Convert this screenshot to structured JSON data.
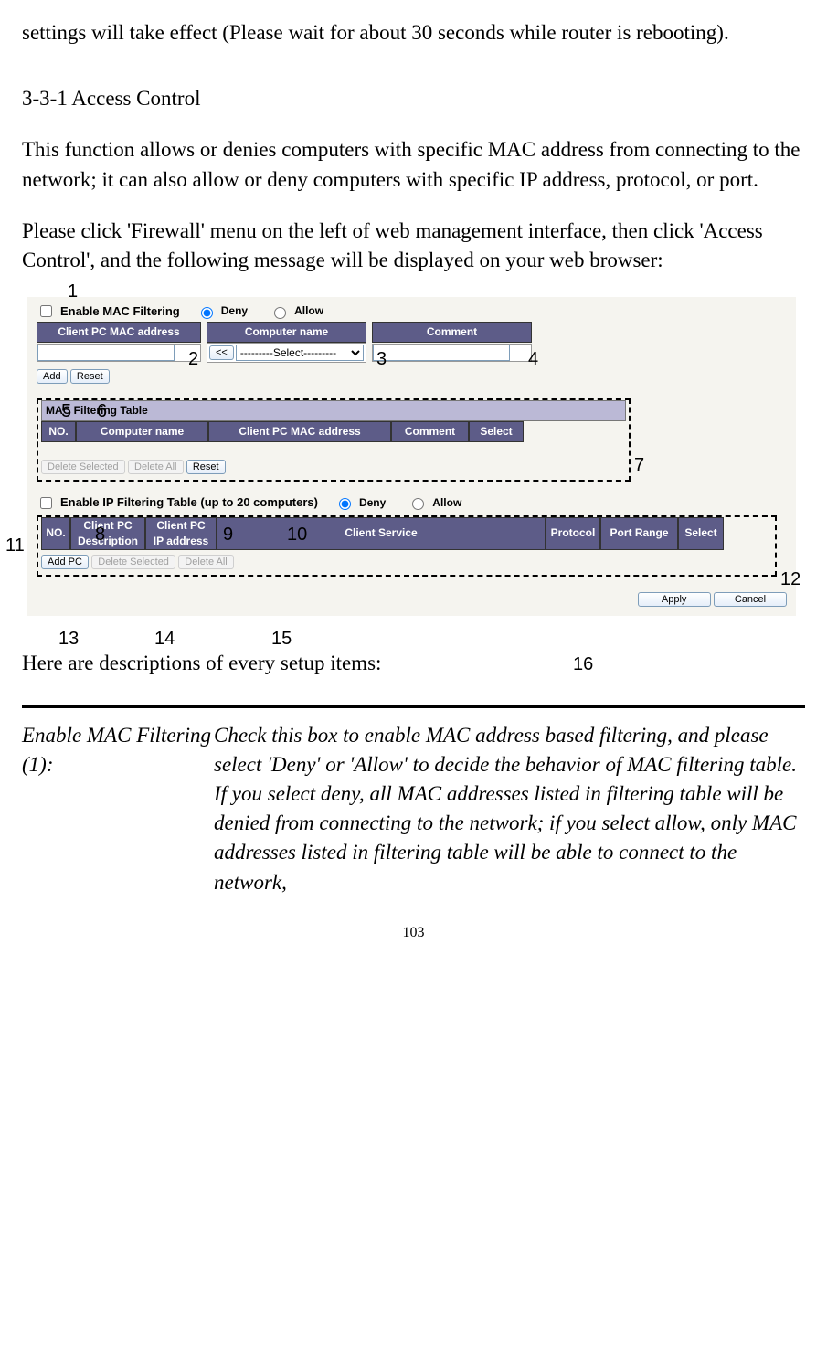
{
  "intro_paragraph": "settings will take effect (Please wait for about 30 seconds while router is rebooting).",
  "section_heading": "3-3-1 Access Control",
  "para1": "This function allows or denies computers with specific MAC address from connecting to the network; it can also allow or deny computers with specific IP address, protocol, or port.",
  "para2": "Please click 'Firewall' menu on the left of web management interface, then click 'Access Control', and the following message will be displayed on your web browser:",
  "ui": {
    "mac_filter": {
      "enable_label": "Enable MAC Filtering",
      "deny": "Deny",
      "allow": "Allow",
      "col_mac": "Client PC MAC address",
      "col_name": "Computer name",
      "col_comment": "Comment",
      "select_placeholder": "---------Select---------",
      "btn_copy": "<<",
      "btn_add": "Add",
      "btn_reset": "Reset",
      "mac_input": "",
      "comment_input": ""
    },
    "mac_table": {
      "title": "MAC Filtering Table",
      "col_no": "NO.",
      "col_name": "Computer name",
      "col_mac": "Client PC MAC address",
      "col_comment": "Comment",
      "col_select": "Select",
      "btn_delete_selected": "Delete Selected",
      "btn_delete_all": "Delete All",
      "btn_reset": "Reset"
    },
    "ip_filter": {
      "enable_label": "Enable IP Filtering Table (up to 20 computers)",
      "deny": "Deny",
      "allow": "Allow",
      "col_no": "NO.",
      "col_desc": "Client PC Description",
      "col_ip": "Client PC IP address",
      "col_service": "Client Service",
      "col_protocol": "Protocol",
      "col_portrange": "Port Range",
      "col_select": "Select",
      "btn_addpc": "Add PC",
      "btn_delete_selected": "Delete Selected",
      "btn_delete_all": "Delete All",
      "btn_apply": "Apply",
      "btn_cancel": "Cancel"
    }
  },
  "annotations": {
    "a1": "1",
    "a2": "2",
    "a3": "3",
    "a4": "4",
    "a5": "5",
    "a6": "6",
    "a7": "7",
    "a8": "8",
    "a9": "9",
    "a10": "10",
    "a11": "11",
    "a12": "12",
    "a13": "13",
    "a14": "14",
    "a15": "15",
    "a16": "16"
  },
  "post_para": "Here are descriptions of every setup items:",
  "desc_item": {
    "label": "Enable MAC Filtering (1):",
    "text": "Check this box to enable MAC address based filtering, and please select 'Deny' or 'Allow' to decide the behavior of MAC filtering table. If you select deny, all MAC addresses listed in filtering table will be denied from connecting to the network; if you select allow, only MAC addresses listed in filtering table will be able to connect to the network,"
  },
  "page_number": "103"
}
